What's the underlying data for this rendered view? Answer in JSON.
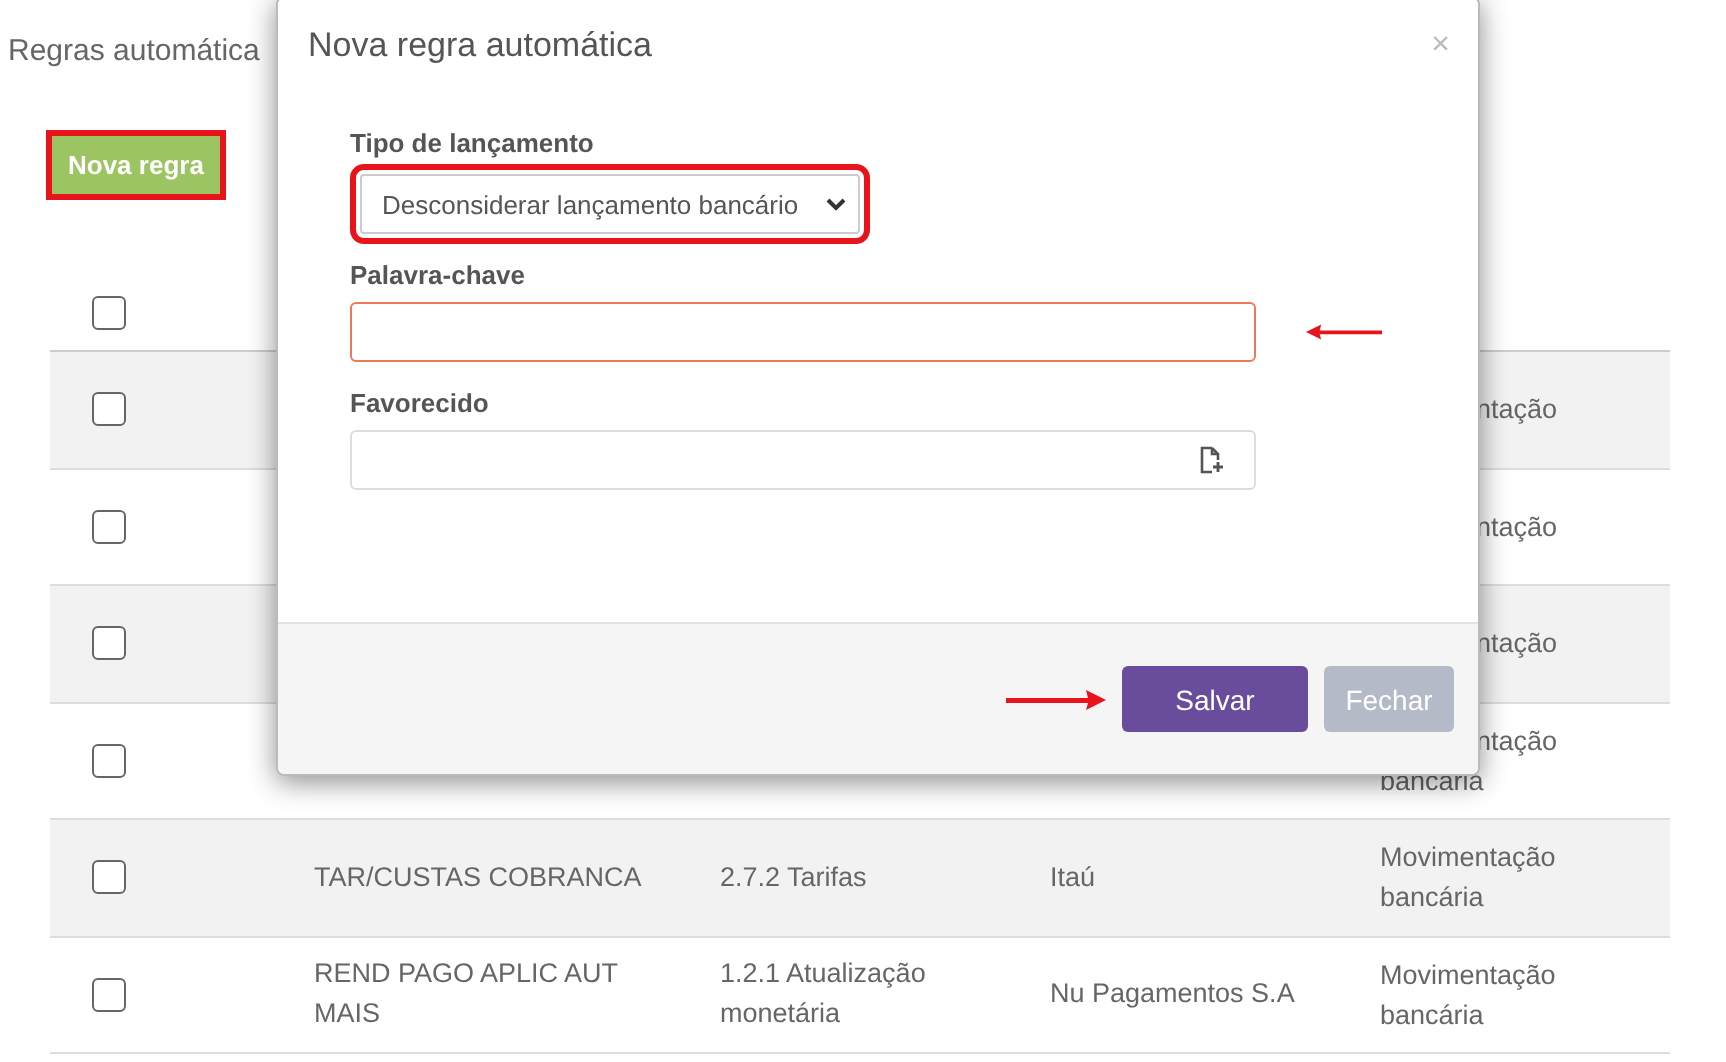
{
  "page": {
    "title": "Regras automática",
    "new_button": {
      "label": "Nova regra",
      "highlighted": true
    }
  },
  "table": {
    "header_checked": false,
    "rows": [
      {
        "checked": false,
        "column_5": [
          {
            "text": "ntação",
            "covered": true
          }
        ]
      },
      {
        "checked": false,
        "column_5": [
          {
            "text": "ntação",
            "covered": true
          }
        ]
      },
      {
        "checked": false,
        "column_5": [
          {
            "text": "ntação",
            "covered": true
          }
        ]
      },
      {
        "checked": false,
        "column_5": [
          {
            "text": "ntação",
            "covered": true
          },
          {
            "text": "bancária"
          }
        ]
      },
      {
        "checked": false,
        "column_2": "TAR/CUSTAS COBRANCA",
        "column_3": "2.7.2 Tarifas",
        "column_4": "Itaú",
        "column_5": [
          {
            "text": "Movimentação"
          },
          {
            "text": "bancária"
          }
        ]
      },
      {
        "checked": false,
        "column_2": "REND PAGO APLIC AUT MAIS",
        "column_3": "1.2.1 Atualização monetária",
        "column_4": "Nu Pagamentos S.A",
        "column_5": [
          {
            "text": "Movimentação"
          },
          {
            "text": "bancária"
          }
        ]
      }
    ]
  },
  "dialog": {
    "title": "Nova regra automática",
    "close_glyph": "×",
    "fields": [
      {
        "kind": "select",
        "label": "Tipo de lançamento",
        "value": "Desconsiderar lançamento bancário",
        "highlighted": true,
        "invalid": false
      },
      {
        "kind": "text",
        "label": "Palavra-chave",
        "highlighted": false,
        "invalid": true,
        "arrow": true
      },
      {
        "kind": "lookup",
        "label": "Favorecido",
        "highlighted": false,
        "invalid": false
      }
    ],
    "buttons": [
      {
        "label": "Salvar",
        "kind": "primary",
        "disabled": false,
        "arrow": true
      },
      {
        "label": "Fechar",
        "kind": "secondary",
        "disabled": true
      }
    ]
  }
}
